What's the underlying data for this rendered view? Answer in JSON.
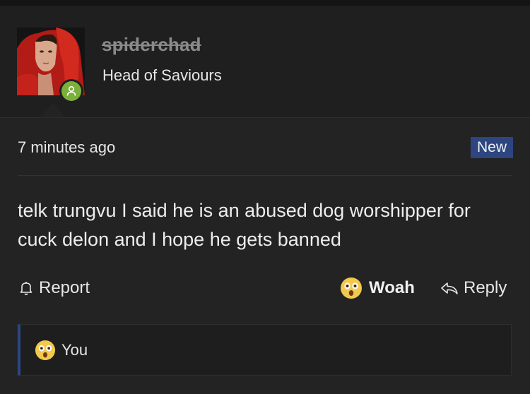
{
  "header": {
    "username": "spiderchad",
    "user_title": "Head of Saviours"
  },
  "post": {
    "time": "7 minutes ago",
    "badge": "New",
    "body": "telk trungvu I said he is an abused dog worshipper for cuck delon and I hope he gets banned"
  },
  "actions": {
    "report_label": "Report",
    "reaction_label": "Woah",
    "reply_label": "Reply"
  },
  "reactions": {
    "users": "You"
  },
  "colors": {
    "online": "#7bb03b",
    "badge_bg": "#2d4681",
    "reaction_emoji": "#f2c94c"
  },
  "icons": {
    "online": "user-icon",
    "report": "bell-icon",
    "reaction": "astonished-face-icon",
    "reply": "reply-arrow-icon"
  }
}
